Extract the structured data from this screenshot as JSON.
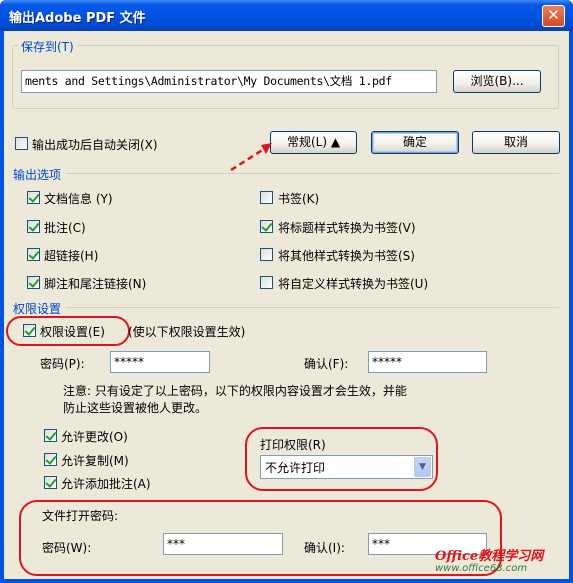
{
  "window": {
    "title": "输出Adobe PDF 文件",
    "close_glyph": "✕"
  },
  "save_to": {
    "label": "保存到(T)",
    "path": "ments and Settings\\Administrator\\My Documents\\文档 1.pdf",
    "browse_label": "浏览(B)..."
  },
  "auto_close": {
    "label": "输出成功后自动关闭(X)",
    "checked": false
  },
  "buttons": {
    "general_label": "常规(L) ▲",
    "ok_label": "确定",
    "cancel_label": "取消"
  },
  "output_options": {
    "heading": "输出选项",
    "left": [
      {
        "label": "文档信息 (Y)",
        "checked": true
      },
      {
        "label": "批注(C)",
        "checked": true
      },
      {
        "label": "超链接(H)",
        "checked": true
      },
      {
        "label": "脚注和尾注链接(N)",
        "checked": true
      }
    ],
    "right": [
      {
        "label": "书签(K)",
        "checked": false
      },
      {
        "label": "将标题样式转换为书签(V)",
        "checked": true
      },
      {
        "label": "将其他样式转换为书签(S)",
        "checked": false
      },
      {
        "label": "将自定义样式转换为书签(U)",
        "checked": false
      }
    ]
  },
  "permissions": {
    "heading": "权限设置",
    "enable_label": "权限设置(E)",
    "enable_hint": "(使以下权限设置生效)",
    "enable_checked": true,
    "password_label": "密码(P):",
    "password_value": "*****",
    "confirm_label": "确认(F):",
    "confirm_value": "*****",
    "note": "注意: 只有设定了以上密码，以下的权限内容设置才会生效，并能",
    "note2": "防止这些设置被他人更改。",
    "allow": [
      {
        "label": "允许更改(O)",
        "checked": true
      },
      {
        "label": "允许复制(M)",
        "checked": true
      },
      {
        "label": "允许添加批注(A)",
        "checked": true
      }
    ],
    "print_label": "打印权限(R)",
    "print_value": "不允许打印",
    "open_password_heading": "文件打开密码:",
    "open_password_label": "密码(W):",
    "open_password_value": "***",
    "open_confirm_label": "确认(I):",
    "open_confirm_value": "***"
  },
  "watermark": {
    "brand": "Office教程学习网",
    "url": "www.office68.com"
  },
  "colors": {
    "annotation": "#e0141c",
    "title_blue": "#0054e3",
    "section_blue": "#0046d5"
  }
}
